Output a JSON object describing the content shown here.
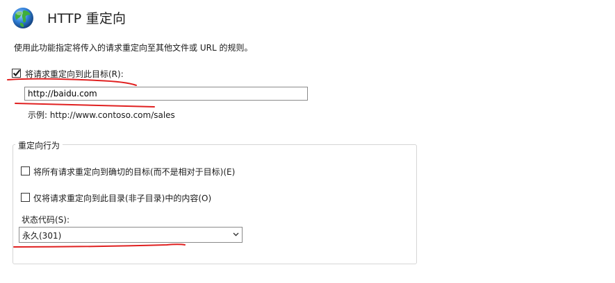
{
  "header": {
    "title": "HTTP 重定向",
    "icon": "globe-icon"
  },
  "description": "使用此功能指定将传入的请求重定向至其他文件或 URL 的规则。",
  "redirect_enable": {
    "label": "将请求重定向到此目标(R):",
    "checked": true
  },
  "target": {
    "value": "http://baidu.com"
  },
  "example": "示例: http://www.contoso.com/sales",
  "behavior": {
    "title": "重定向行为",
    "exact_destination": {
      "label": "将所有请求重定向到确切的目标(而不是相对于目标)(E)",
      "checked": false
    },
    "only_this_directory": {
      "label": "仅将请求重定向到此目录(非子目录)中的内容(O)",
      "checked": false
    },
    "status_code": {
      "label": "状态代码(S):",
      "value": "永久(301)"
    }
  },
  "colors": {
    "annotation": "#e02020",
    "globe_blue": "#2f7fd8",
    "globe_green": "#3fae3b"
  }
}
